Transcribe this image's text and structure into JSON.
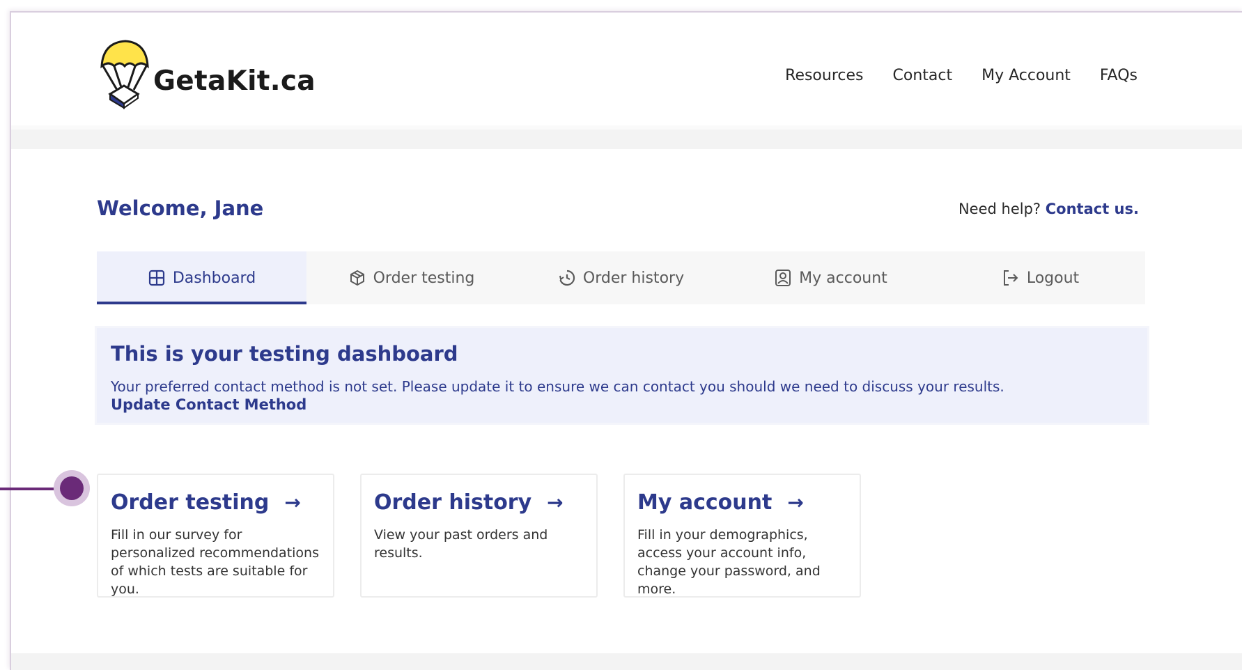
{
  "brand": {
    "logo_text": "GetaKit.ca"
  },
  "topnav": [
    "Resources",
    "Contact",
    "My Account",
    "FAQs"
  ],
  "welcome": "Welcome, Jane",
  "help": {
    "prefix": "Need help?",
    "link": "Contact us."
  },
  "tabs": [
    {
      "label": "Dashboard",
      "icon": "grid-icon",
      "active": true
    },
    {
      "label": "Order testing",
      "icon": "box-icon",
      "active": false
    },
    {
      "label": "Order history",
      "icon": "history-icon",
      "active": false
    },
    {
      "label": "My account",
      "icon": "user-icon",
      "active": false
    },
    {
      "label": "Logout",
      "icon": "logout-icon",
      "active": false
    }
  ],
  "alert": {
    "title": "This is your testing dashboard",
    "message": "Your preferred contact method is not set. Please update it to ensure we can contact you should we need to discuss your results.",
    "link": "Update Contact Method"
  },
  "cards": [
    {
      "title": "Order testing",
      "arrow": "→",
      "desc": "Fill in our survey for personalized recommendations of which tests are suitable for you."
    },
    {
      "title": "Order history",
      "arrow": "→",
      "desc": "View your past orders and results."
    },
    {
      "title": "My account",
      "arrow": "→",
      "desc": "Fill in your demographics, access your account info, change your password, and more."
    }
  ],
  "colors": {
    "primary": "#2d3a8c",
    "alert_bg": "#eef0fb",
    "pointer": "#6a2a78"
  }
}
